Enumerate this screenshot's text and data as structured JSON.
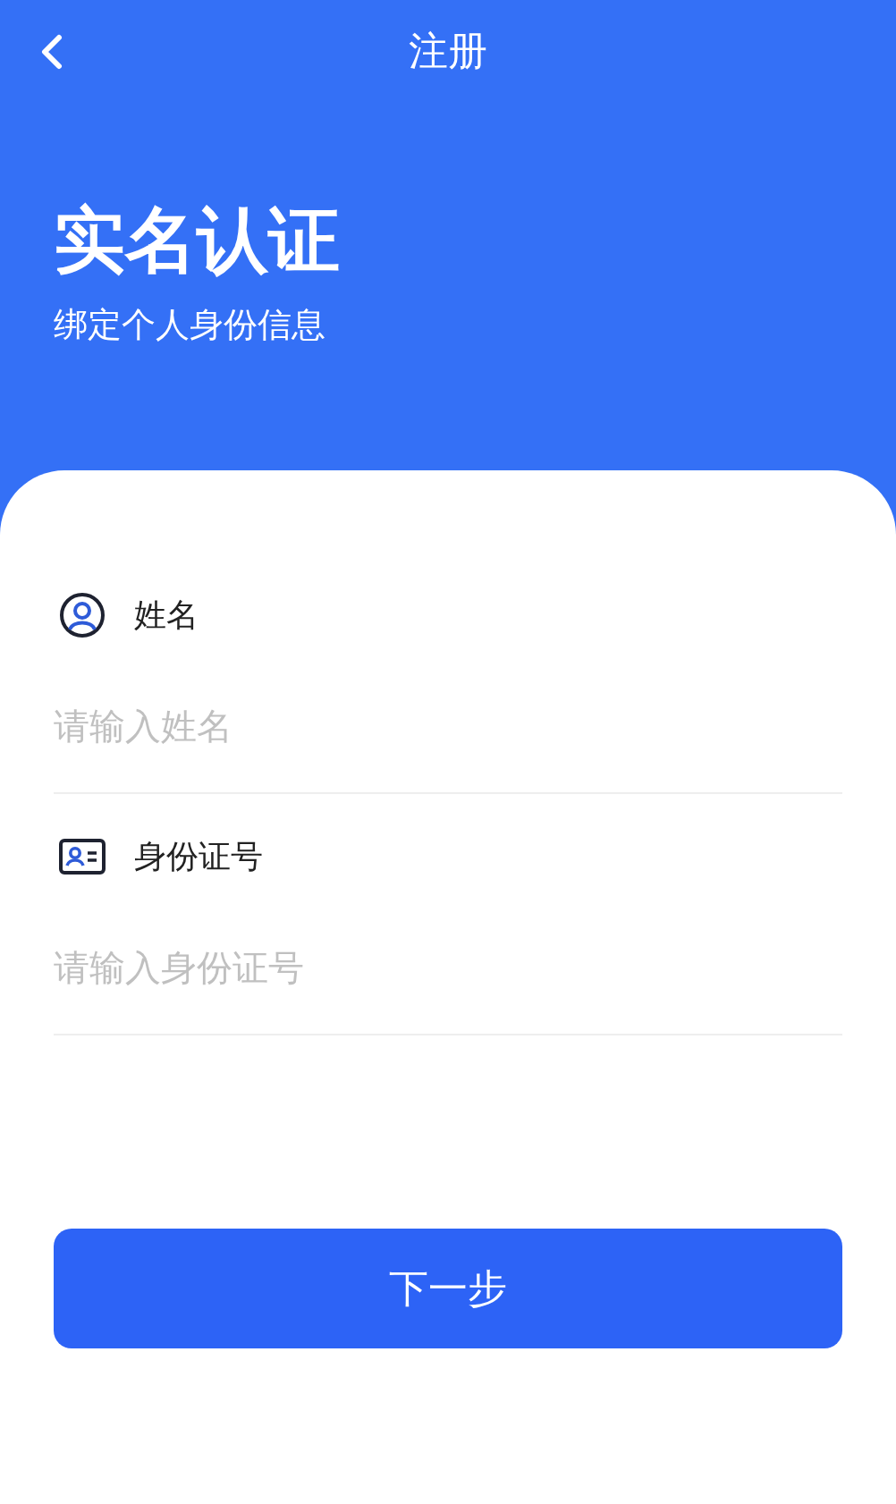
{
  "nav": {
    "title": "注册"
  },
  "header": {
    "title": "实名认证",
    "subtitle": "绑定个人身份信息"
  },
  "fields": [
    {
      "kind": "person",
      "label": "姓名",
      "placeholder": "请输入姓名"
    },
    {
      "kind": "id-card",
      "label": "身份证号",
      "placeholder": "请输入身份证号"
    }
  ],
  "button": {
    "label": "下一步"
  }
}
